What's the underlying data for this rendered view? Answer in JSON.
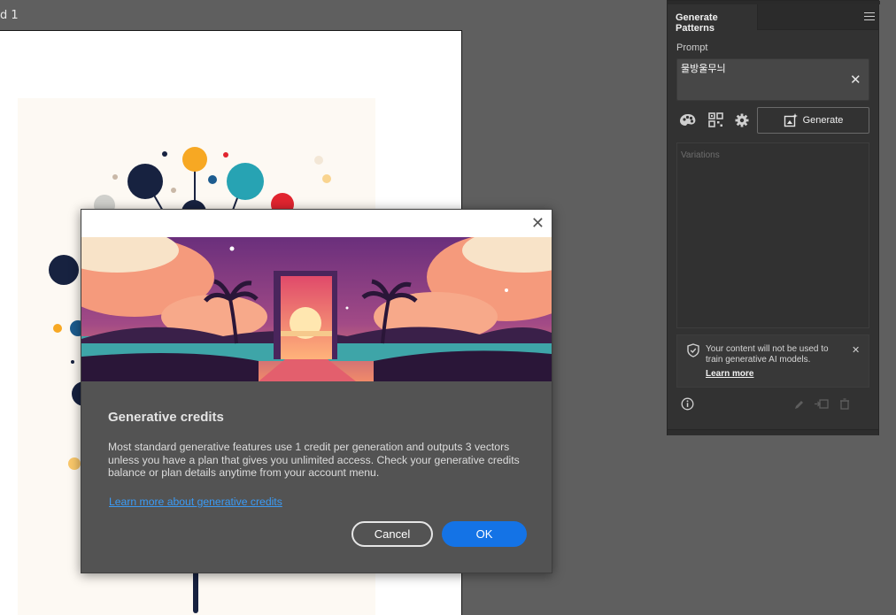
{
  "document": {
    "tab_label": "d 1"
  },
  "panel": {
    "tab_title": "Generate Patterns",
    "prompt_label": "Prompt",
    "prompt_value": "물방울무늬",
    "generate_label": "Generate",
    "variations_label": "Variations",
    "notice_text": "Your content will not be used to train generative AI models.",
    "notice_link": "Learn more"
  },
  "dialog": {
    "title": "Generative credits",
    "body": "Most standard generative features use 1 credit per generation and outputs 3 vectors unless you have a plan that gives you unlimited access. Check your generative credits balance or plan details anytime from your account menu.",
    "link": "Learn more about generative credits",
    "cancel_label": "Cancel",
    "ok_label": "OK"
  },
  "colors": {
    "accent": "#1473e6",
    "link": "#3b9bf5",
    "panel_bg": "#323232",
    "dialog_bg": "#535353"
  },
  "icons": {
    "panel_menu": "hamburger-icon",
    "clear": "close-icon",
    "style_picker": "palette-icon",
    "pattern_type": "qr-grid-icon",
    "settings": "gear-icon",
    "generate": "sparkle-image-icon",
    "notice": "shield-check-icon",
    "info": "info-icon",
    "edit": "pencil-icon",
    "add": "add-to-swatches-icon",
    "delete": "trash-icon",
    "dialog_close": "close-icon"
  }
}
